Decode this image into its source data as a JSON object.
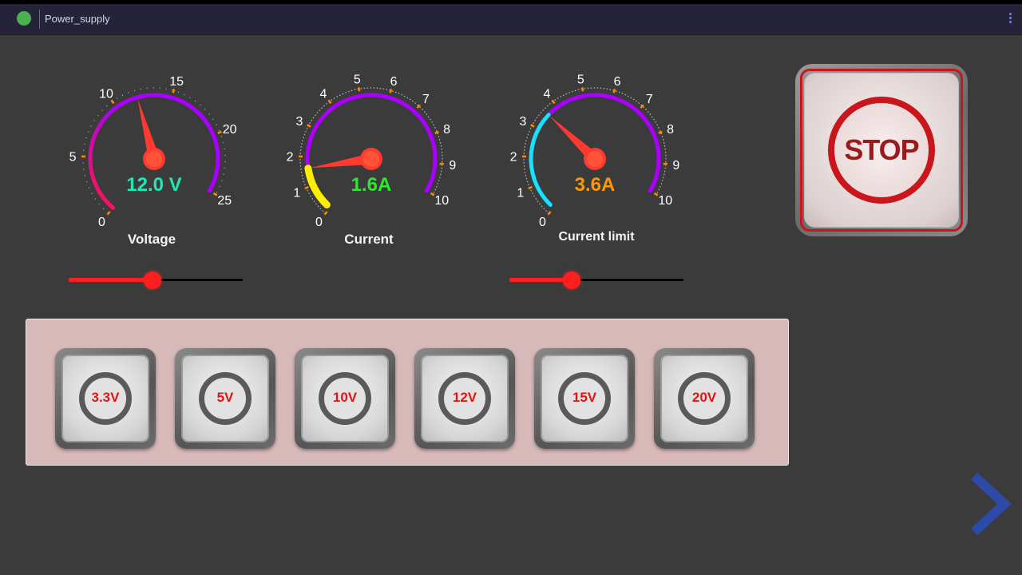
{
  "window": {
    "title": "Power_supply"
  },
  "gauges": [
    {
      "id": "voltage",
      "label": "Voltage",
      "readout": "12.0 V",
      "value": 12.0,
      "min": 0,
      "max": 25,
      "ticks": [
        "0",
        "5",
        "10",
        "15",
        "20",
        "25"
      ],
      "readout_color": "#1de9b6",
      "arc_colors": [
        "#ff1744",
        "#aa00ff"
      ]
    },
    {
      "id": "current",
      "label": "Current",
      "readout": "1.6A",
      "value": 1.6,
      "min": 0,
      "max": 10,
      "ticks": [
        "0",
        "1",
        "2",
        "3",
        "4",
        "5",
        "6",
        "7",
        "8",
        "9",
        "10"
      ],
      "readout_color": "#2ee82e",
      "arc_colors": [
        "#ffee00",
        "#aa00ff"
      ]
    },
    {
      "id": "current_limit",
      "label": "Current limit",
      "readout": "3.6A",
      "value": 3.6,
      "min": 0,
      "max": 10,
      "ticks": [
        "0",
        "1",
        "2",
        "3",
        "4",
        "5",
        "6",
        "7",
        "8",
        "9",
        "10"
      ],
      "readout_color": "#ff9800",
      "arc_colors": [
        "#18e0ff",
        "#aa00ff"
      ]
    }
  ],
  "sliders": {
    "voltage": {
      "fraction": 0.48
    },
    "current_limit": {
      "fraction": 0.36
    }
  },
  "presets": [
    "3.3V",
    "5V",
    "10V",
    "12V",
    "15V",
    "20V"
  ],
  "stop": {
    "label": "STOP"
  },
  "colors": {
    "accent_red": "#ff1f1f",
    "nav_arrow": "#2d4aa8"
  }
}
